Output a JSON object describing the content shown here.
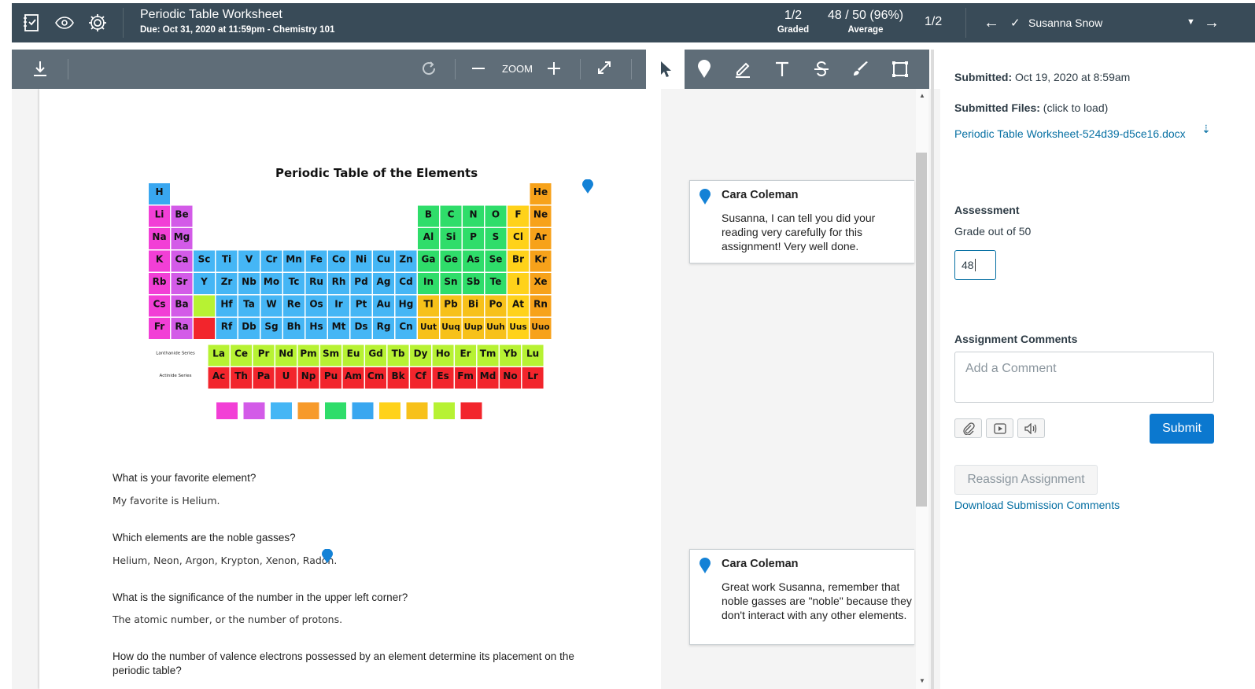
{
  "topbar": {
    "title": "Periodic Table Worksheet",
    "subtitle": "Due: Oct 31, 2020 at 11:59pm - Chemistry 101",
    "graded_value": "1/2",
    "graded_label": "Graded",
    "average_value": "48 / 50 (96%)",
    "average_label": "Average",
    "nav_count": "1/2",
    "student_name": "Susanna Snow"
  },
  "doc_toolbar": {
    "zoom_label": "ZOOM"
  },
  "document": {
    "table_title": "Periodic Table of the Elements",
    "qa": [
      {
        "q": "What is your favorite element?",
        "a": "My favorite is Helium."
      },
      {
        "q": "Which elements are the noble gasses?",
        "a": "Helium, Neon, Argon, Krypton, Xenon, Radon."
      },
      {
        "q": "What is the significance of the number in the upper left corner?",
        "a": "The atomic number, or the number of protons."
      },
      {
        "q": "How do the number of valence electrons possessed by an element determine its placement on the periodic table?",
        "a": ""
      }
    ],
    "elements_row1": [
      "H",
      "",
      "",
      "",
      "",
      "",
      "",
      "",
      "",
      "",
      "",
      "",
      "",
      "",
      "",
      "",
      "",
      "He"
    ],
    "elements_row2": [
      "Li",
      "Be",
      "",
      "",
      "",
      "",
      "",
      "",
      "",
      "",
      "",
      "",
      "B",
      "C",
      "N",
      "O",
      "F",
      "Ne"
    ],
    "elements_row3": [
      "Na",
      "Mg",
      "",
      "",
      "",
      "",
      "",
      "",
      "",
      "",
      "",
      "",
      "Al",
      "Si",
      "P",
      "S",
      "Cl",
      "Ar"
    ],
    "elements_row4": [
      "K",
      "Ca",
      "Sc",
      "Ti",
      "V",
      "Cr",
      "Mn",
      "Fe",
      "Co",
      "Ni",
      "Cu",
      "Zn",
      "Ga",
      "Ge",
      "As",
      "Se",
      "Br",
      "Kr"
    ],
    "elements_row5": [
      "Rb",
      "Sr",
      "Y",
      "Zr",
      "Nb",
      "Mo",
      "Tc",
      "Ru",
      "Rh",
      "Pd",
      "Ag",
      "Cd",
      "In",
      "Sn",
      "Sb",
      "Te",
      "I",
      "Xe"
    ],
    "elements_row6": [
      "Cs",
      "Ba",
      "",
      "Hf",
      "Ta",
      "W",
      "Re",
      "Os",
      "Ir",
      "Pt",
      "Au",
      "Hg",
      "Tl",
      "Pb",
      "Bi",
      "Po",
      "At",
      "Rn"
    ],
    "elements_row7": [
      "Fr",
      "Ra",
      "",
      "Rf",
      "Db",
      "Sg",
      "Bh",
      "Hs",
      "Mt",
      "Ds",
      "Rg",
      "Cn",
      "Uut",
      "Uuq",
      "Uup",
      "Uuh",
      "Uus",
      "Uuo"
    ],
    "lanthanides": [
      "La",
      "Ce",
      "Pr",
      "Nd",
      "Pm",
      "Sm",
      "Eu",
      "Gd",
      "Tb",
      "Dy",
      "Ho",
      "Er",
      "Tm",
      "Yb",
      "Lu"
    ],
    "actinides": [
      "Ac",
      "Th",
      "Pa",
      "U",
      "Np",
      "Pu",
      "Am",
      "Cm",
      "Bk",
      "Cf",
      "Es",
      "Fm",
      "Md",
      "No",
      "Lr"
    ],
    "lanthanide_label": "Lanthanide Series",
    "actinide_label": "Actinide Series"
  },
  "comments": [
    {
      "author": "Cara Coleman",
      "text": "Susanna, I can tell you did your reading very carefully for this assignment! Very well done."
    },
    {
      "author": "Cara Coleman",
      "text": "Great work Susanna, remember that noble gasses are \"noble\" because they don't interact with any other elements."
    }
  ],
  "right_panel": {
    "submitted_label": "Submitted:",
    "submitted_value": "Oct 19, 2020 at 8:59am",
    "files_label": "Submitted Files:",
    "files_hint": "(click to load)",
    "file_name": "Periodic Table Worksheet-524d39-d5ce16.docx",
    "assessment_label": "Assessment",
    "grade_out_of": "Grade out of 50",
    "grade_value": "48",
    "comments_label": "Assignment Comments",
    "comment_placeholder": "Add a Comment",
    "submit_label": "Submit",
    "reassign_label": "Reassign Assignment",
    "download_comments_label": "Download Submission Comments"
  },
  "colors": {
    "topbar": "#394b58",
    "toolbar": "#5f6d78",
    "link": "#0770a3",
    "submit": "#0b78cf",
    "pin": "#1482d6"
  }
}
